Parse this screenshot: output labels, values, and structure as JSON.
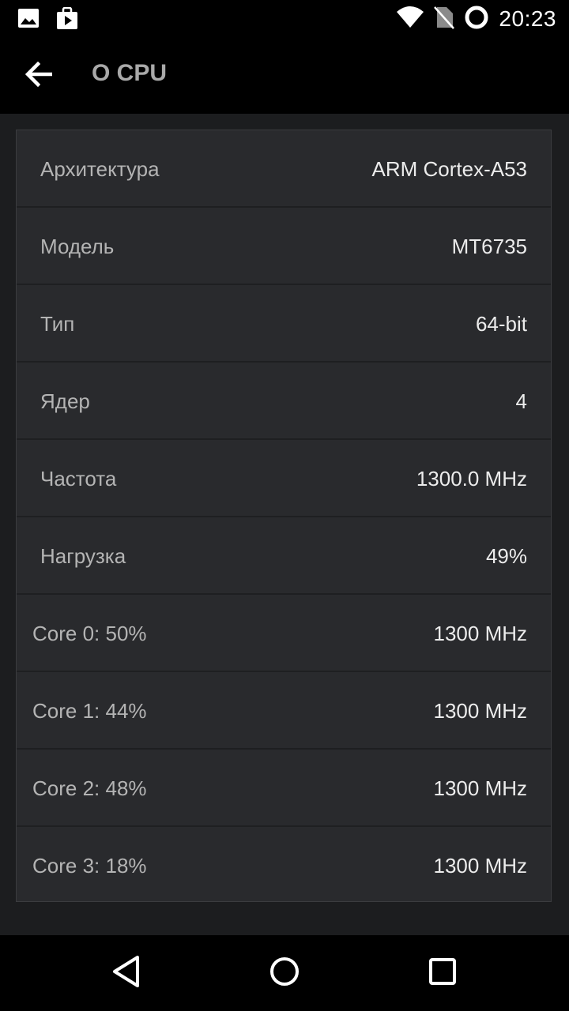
{
  "status_bar": {
    "time": "20:23",
    "icons": [
      "image-icon",
      "store-icon",
      "wifi-icon",
      "no-sim-icon",
      "sync-circle-icon"
    ]
  },
  "app_bar": {
    "title": "О CPU",
    "back_icon": "arrow-back-icon"
  },
  "info_rows": [
    {
      "label": "Архитектура",
      "value": "ARM Cortex-A53"
    },
    {
      "label": "Модель",
      "value": "MT6735"
    },
    {
      "label": "Тип",
      "value": "64-bit"
    },
    {
      "label": "Ядер",
      "value": "4"
    },
    {
      "label": "Частота",
      "value": "1300.0 MHz"
    },
    {
      "label": "Нагрузка",
      "value": "49%"
    }
  ],
  "core_rows": [
    {
      "label": "Core 0: 50%",
      "value": "1300 MHz"
    },
    {
      "label": "Core 1: 44%",
      "value": "1300 MHz"
    },
    {
      "label": "Core 2: 48%",
      "value": "1300 MHz"
    },
    {
      "label": "Core 3: 18%",
      "value": "1300 MHz"
    }
  ],
  "nav_bar": {
    "icons": [
      "back-triangle-icon",
      "home-circle-icon",
      "recents-square-icon"
    ]
  },
  "colors": {
    "background": "#1c1d1f",
    "card": "#292a2d",
    "bar": "#000000"
  }
}
